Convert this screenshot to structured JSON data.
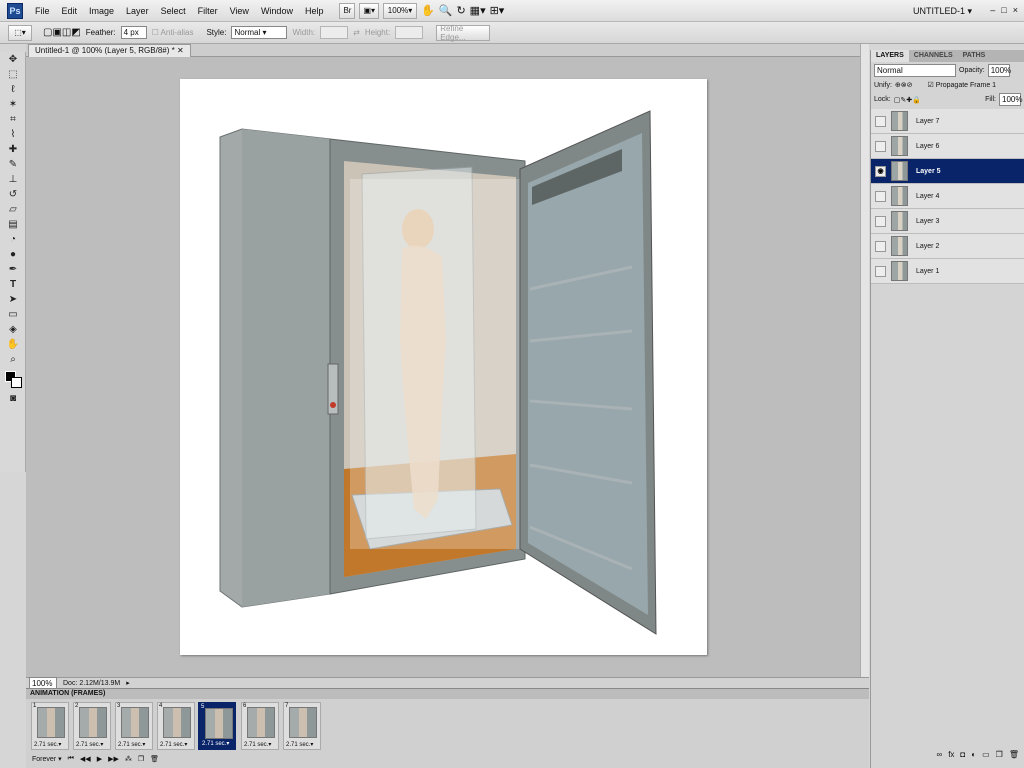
{
  "app": {
    "logo": "Ps",
    "doc_title": "UNTITLED-1",
    "window_btns": [
      "–",
      "□",
      "×"
    ]
  },
  "menu": [
    "File",
    "Edit",
    "Image",
    "Layer",
    "Select",
    "Filter",
    "View",
    "Window",
    "Help"
  ],
  "menu_tools": {
    "bridge": "Br",
    "zoom": "100%"
  },
  "options": {
    "feather_label": "Feather:",
    "feather_value": "4 px",
    "antialias": "Anti-alias",
    "style_label": "Style:",
    "style_value": "Normal",
    "width_label": "Width:",
    "height_label": "Height:",
    "refine": "Refine Edge..."
  },
  "document": {
    "tab": "Untitled-1 @ 100% (Layer 5, RGB/8#) *"
  },
  "status": {
    "zoom": "100%",
    "doc": "Doc: 2.12M/13.9M"
  },
  "layers_panel": {
    "tabs": [
      "LAYERS",
      "CHANNELS",
      "PATHS"
    ],
    "blend": "Normal",
    "opacity_label": "Opacity:",
    "opacity": "100%",
    "unify": "Unify:",
    "propagate": "Propagate Frame 1",
    "lock": "Lock:",
    "fill_label": "Fill:",
    "fill": "100%",
    "layers": [
      {
        "name": "Layer 7",
        "visible": false
      },
      {
        "name": "Layer 6",
        "visible": false
      },
      {
        "name": "Layer 5",
        "visible": true,
        "selected": true
      },
      {
        "name": "Layer 4",
        "visible": false
      },
      {
        "name": "Layer 3",
        "visible": false
      },
      {
        "name": "Layer 2",
        "visible": false
      },
      {
        "name": "Layer 1",
        "visible": false
      }
    ]
  },
  "animation": {
    "title": "ANIMATION (FRAMES)",
    "frames": [
      {
        "n": "1",
        "delay": "2.71 sec."
      },
      {
        "n": "2",
        "delay": "2.71 sec."
      },
      {
        "n": "3",
        "delay": "2.71 sec."
      },
      {
        "n": "4",
        "delay": "2.71 sec."
      },
      {
        "n": "5",
        "delay": "2.71 sec.",
        "selected": true
      },
      {
        "n": "6",
        "delay": "2.71 sec."
      },
      {
        "n": "7",
        "delay": "2.71 sec."
      }
    ],
    "loop": "Forever"
  }
}
